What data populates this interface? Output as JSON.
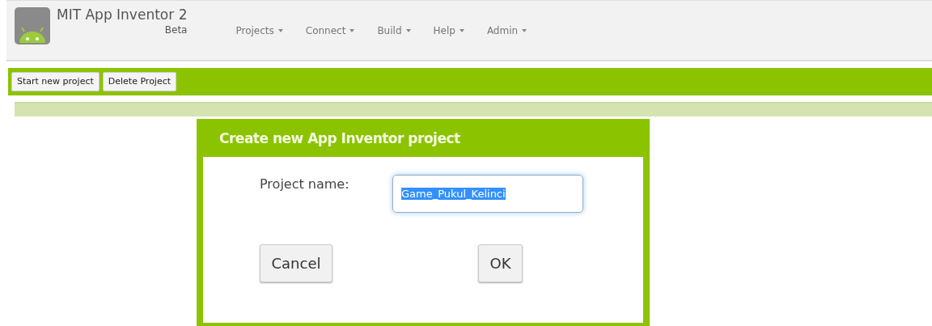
{
  "app": {
    "title": "MIT App Inventor 2",
    "subtitle": "Beta"
  },
  "menu": [
    {
      "label": "Projects"
    },
    {
      "label": "Connect"
    },
    {
      "label": "Build"
    },
    {
      "label": "Help"
    },
    {
      "label": "Admin"
    }
  ],
  "toolbar": [
    "Start new project",
    "Delete Project"
  ],
  "dialog": {
    "title": "Create new App Inventor project",
    "field_label": "Project name:",
    "value": "Game_Pukul_Kelinci",
    "value_selected": true,
    "buttons": [
      "Cancel",
      "OK"
    ]
  }
}
